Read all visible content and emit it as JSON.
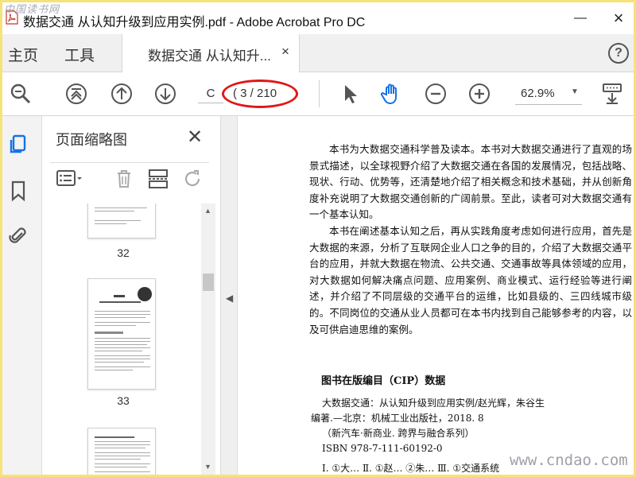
{
  "window": {
    "title": "数据交通  从认知升级到应用实例.pdf - Adobe Acrobat Pro DC",
    "watermark_top": "中国读书网",
    "watermark_bottom": "www.cndao.com"
  },
  "tabs": {
    "home": "主页",
    "tools": "工具",
    "document": "数据交通  从认知升...",
    "close_symbol": "×"
  },
  "toolbar": {
    "page_input": "C",
    "page_count": "( 3 / 210",
    "zoom": "62.9%",
    "highlight_color": "#e01818"
  },
  "thumbnail_panel": {
    "title": "页面缩略图",
    "close_symbol": "✕",
    "pages": [
      "32",
      "33"
    ]
  },
  "document": {
    "paragraphs": [
      "本书为大数据交通科学普及读本。本书对大数据交通进行了直观的场景式描述，以全球视野介绍了大数据交通在各国的发展情况，包括战略、现状、行动、优势等，还清楚地介绍了相关概念和技术基础，并从创新角度补充说明了大数据交通创新的广阔前景。至此，读者可对大数据交通有一个基本认知。",
      "本书在阐述基本认知之后，再从实践角度考虑如何进行应用，首先是大数据的来源，分析了互联网企业人口之争的目的，介绍了大数据交通平台的应用，并就大数据在物流、公共交通、交通事故等具体领域的应用，对大数据如何解决痛点问题、应用案例、商业模式、运行经验等进行阐述，并介绍了不同层级的交通平台的运维，比如县级的、三四线城市级的。不同岗位的交通从业人员都可在本书内找到自己能够参考的内容，以及可供启迪思维的案例。"
    ],
    "cip_title": "图书在版编目（CIP）数据",
    "cip_lines": [
      "大数据交通：从认知升级到应用实例/赵光辉，朱谷生",
      "编著.—北京：机械工业出版社，2018. 8",
      "（新汽车·新商业. 跨界与融合系列）",
      "ISBN 978-7-111-60192-0",
      "Ⅰ. ①大…  Ⅱ. ①赵…  ②朱…  Ⅲ. ①交通系统"
    ]
  }
}
